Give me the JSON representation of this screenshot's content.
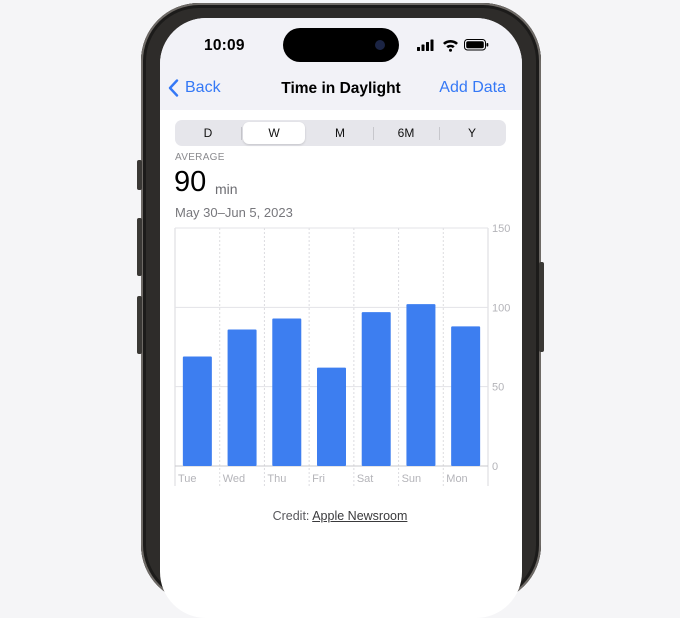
{
  "status_bar": {
    "time": "10:09"
  },
  "nav": {
    "back_label": "Back",
    "title": "Time in Daylight",
    "add_label": "Add Data"
  },
  "segments": [
    "D",
    "W",
    "M",
    "6M",
    "Y"
  ],
  "selected_segment": "W",
  "summary": {
    "label": "AVERAGE",
    "value": "90",
    "unit": "min",
    "date_range": "May 30–Jun 5, 2023"
  },
  "chart_data": {
    "type": "bar",
    "categories": [
      "Tue",
      "Wed",
      "Thu",
      "Fri",
      "Sat",
      "Sun",
      "Mon"
    ],
    "values": [
      69,
      86,
      93,
      62,
      97,
      102,
      88
    ],
    "ylim": [
      0,
      150
    ],
    "yticks": [
      "0",
      "50",
      "100",
      "150"
    ],
    "ytick_values": [
      0,
      50,
      100,
      150
    ],
    "bar_color": "#3d7ef0",
    "grid": true
  },
  "credit": {
    "prefix": "Credit:",
    "link": "Apple Newsroom"
  },
  "colors": {
    "accent": "#3478f6",
    "bar": "#3d7ef0"
  }
}
